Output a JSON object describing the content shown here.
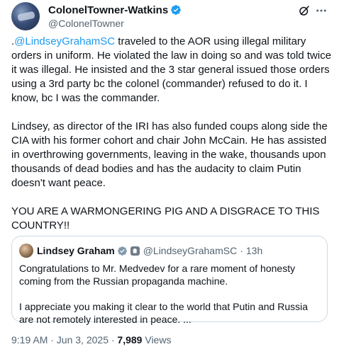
{
  "author": {
    "display_name": "ColonelTowner-Watkins",
    "handle": "@ColonelTowner"
  },
  "header_icons": [
    "verified-badge-icon",
    "grok-icon",
    "more-icon"
  ],
  "post": {
    "para1_prefix": ".",
    "para1_mention": "@LindseyGrahamSC",
    "para1_rest": " traveled to the AOR using illegal military orders in uniform. He violated the law in doing so and was told twice it was illegal. He insisted and the 3 star general issued those orders using a 3rd party bc the colonel (commander) refused to do it. I know, bc I was the commander.",
    "para2": "Lindsey, as director of the IRI has also funded coups along side the CIA with his former cohort and chair John McCain. He has assisted in overthrowing governments, leaving in the wake, thousands upon thousands of dead bodies and has the audacity to claim Putin doesn't want peace.",
    "para3": "YOU ARE A WARMONGERING PIG AND A DISGRACE TO THIS COUNTRY!!"
  },
  "quote": {
    "display_name": "Lindsey Graham",
    "handle": "@LindseyGrahamSC",
    "dot": "·",
    "time": "13h",
    "para1": "Congratulations to Mr. Medvedev for a rare moment of honesty coming from the Russian propaganda machine.",
    "para2": "I appreciate you making it clear to the world that Putin and Russia are not remotely interested in peace. ..."
  },
  "meta": {
    "timestamp": "9:19 AM · Jun 3, 2025 · ",
    "views_count": "7,989",
    "views_label": " Views"
  },
  "colors": {
    "link": "#1d9bf0",
    "verified": "#1d9bf0",
    "secondary_text": "#536471",
    "border": "#cfd9de"
  }
}
